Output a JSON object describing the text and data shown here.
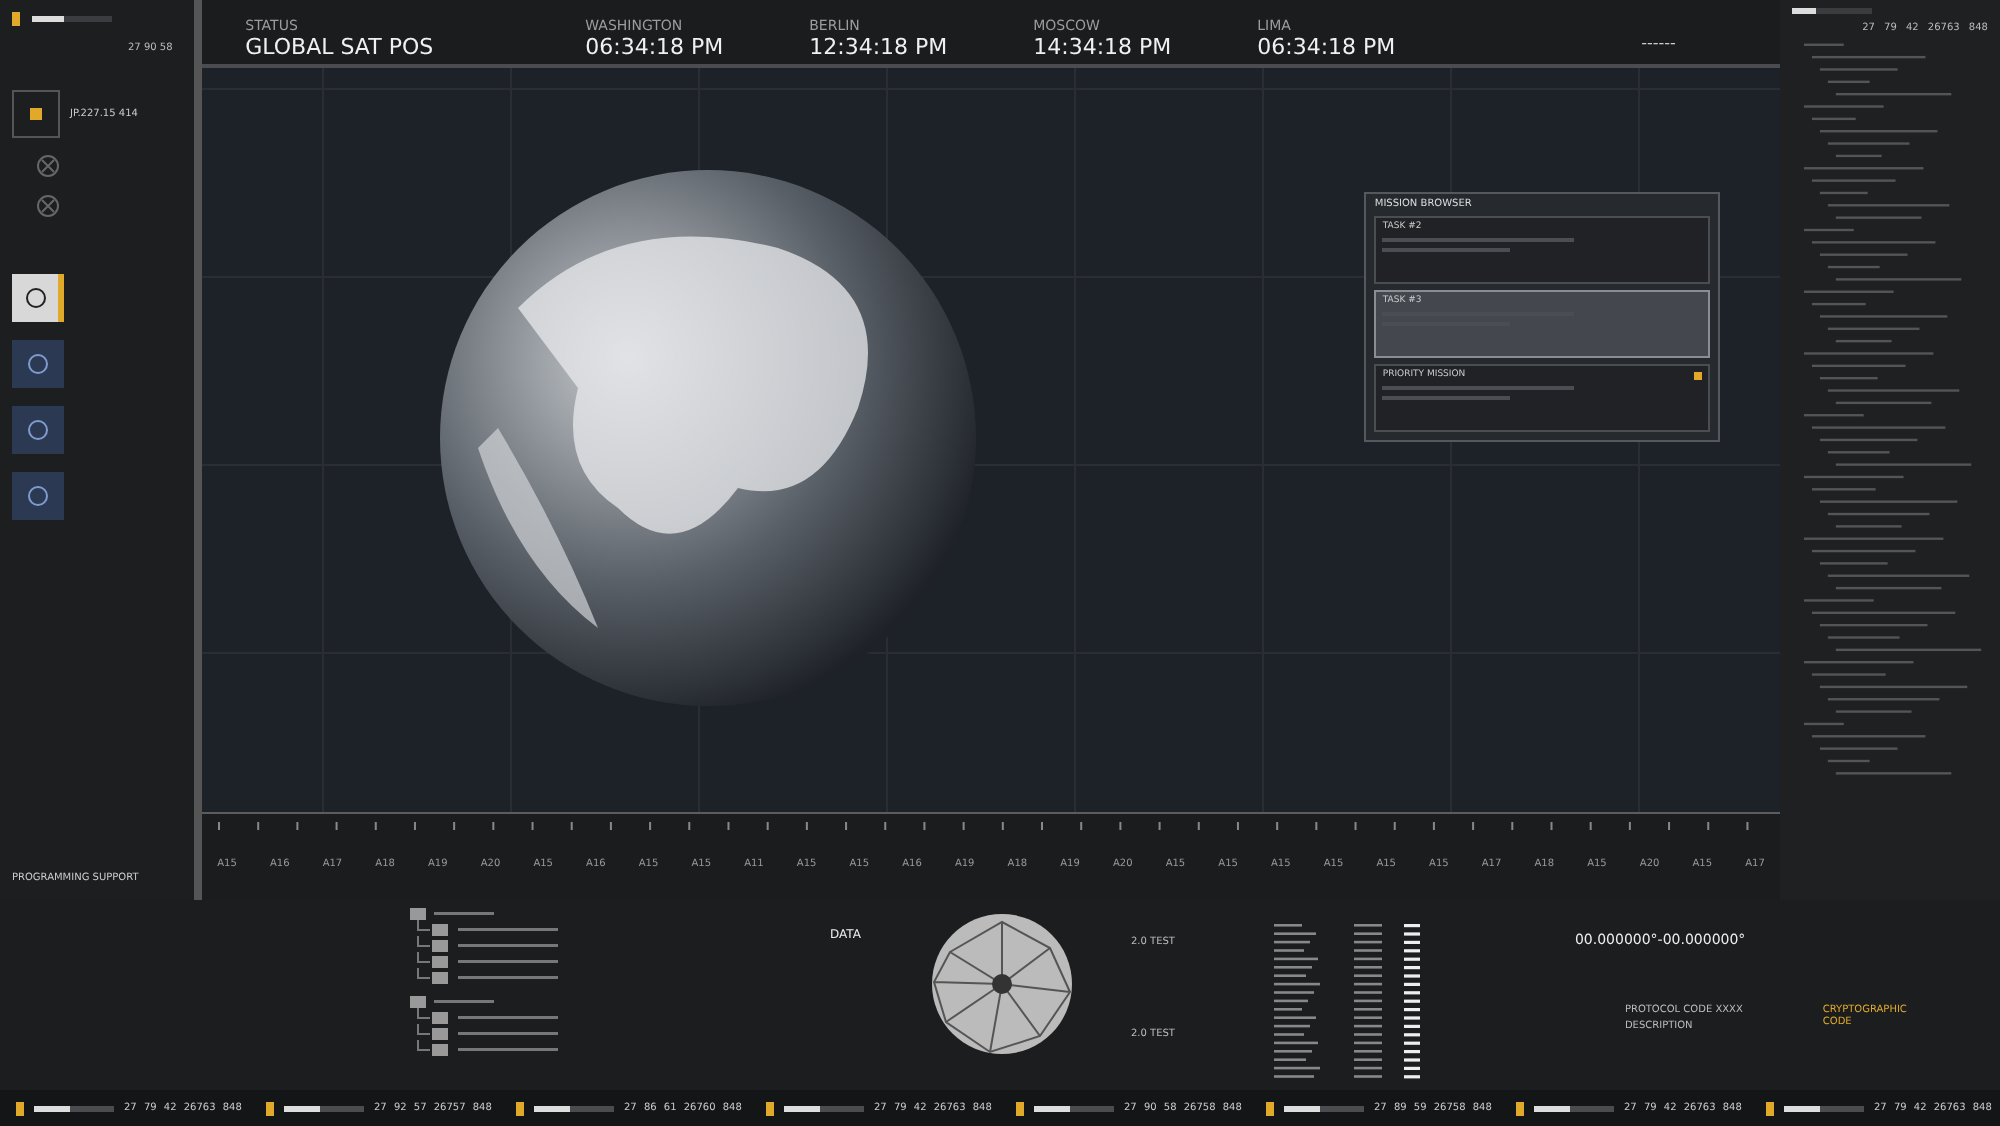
{
  "left_panel": {
    "readout": "27 90 58",
    "progress": {
      "level": 0.4
    },
    "target": {
      "code": "JP.227.15 414"
    },
    "mode_buttons": [
      {
        "selected": true
      },
      {
        "selected": false
      },
      {
        "selected": false
      },
      {
        "selected": false
      }
    ],
    "code_title": "PROGRAMMING SUPPORT"
  },
  "header": {
    "status_label": "STATUS",
    "status_value": "GLOBAL SAT POS",
    "clocks": [
      {
        "city": "WASHINGTON",
        "time": "06:34:18 PM"
      },
      {
        "city": "BERLIN",
        "time": "12:34:18 PM"
      },
      {
        "city": "MOSCOW",
        "time": "14:34:18 PM"
      },
      {
        "city": "LIMA",
        "time": "06:34:18 PM"
      }
    ],
    "dashes": "------"
  },
  "mission_browser": {
    "title": "MISSION BROWSER",
    "tasks": [
      {
        "title": "TASK #2",
        "highlighted": false,
        "flagged": false
      },
      {
        "title": "TASK #3",
        "highlighted": true,
        "flagged": false
      },
      {
        "title": "PRIORITY MISSION",
        "highlighted": false,
        "flagged": true
      }
    ]
  },
  "ruler": {
    "labels": [
      "A15",
      "A16",
      "A17",
      "A18",
      "A19",
      "A20",
      "A15",
      "A16",
      "A15",
      "A15",
      "A11",
      "A15",
      "A15",
      "A16",
      "A19",
      "A18",
      "A19",
      "A20",
      "A15",
      "A15",
      "A15",
      "A15",
      "A15",
      "A15",
      "A17",
      "A18",
      "A15",
      "A20",
      "A15",
      "A17"
    ]
  },
  "right_panel": {
    "readout": "27 79 42 26763 848",
    "progress": {
      "level": 0.3
    }
  },
  "bottom": {
    "data_label": "DATA",
    "test_labels": [
      "2.0 TEST",
      "2.0 TEST"
    ],
    "coordinates": "00.000000°-00.000000°",
    "protocol": "PROTOCOL CODE XXXX",
    "description": "DESCRIPTION",
    "crypto": "CRYPTOGRAPHIC CODE"
  },
  "footer": {
    "meters": [
      {
        "level": 0.45,
        "readout": "27 79 42 26763 848"
      },
      {
        "level": 0.45,
        "readout": "27 92 57 26757 848"
      },
      {
        "level": 0.45,
        "readout": "27 86 61 26760 848"
      },
      {
        "level": 0.45,
        "readout": "27 79 42 26763 848"
      },
      {
        "level": 0.45,
        "readout": "27 90 58 26758 848"
      },
      {
        "level": 0.45,
        "readout": "27 89 59 26758 848"
      },
      {
        "level": 0.45,
        "readout": "27 79 42 26763 848"
      },
      {
        "level": 0.45,
        "readout": "27 79 42 26763 848"
      }
    ]
  }
}
